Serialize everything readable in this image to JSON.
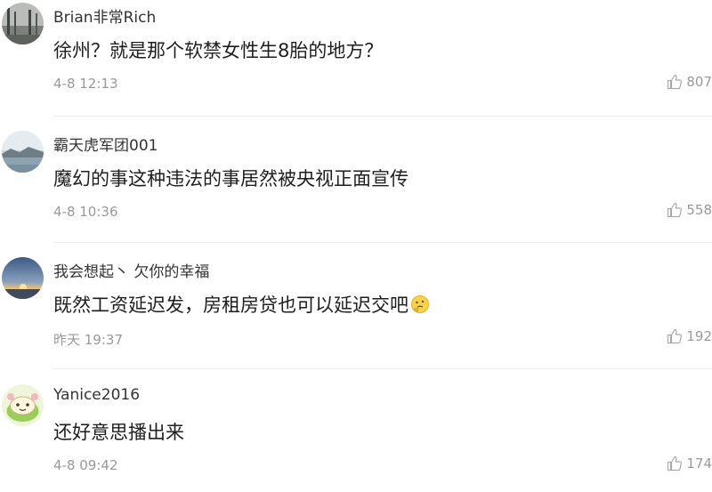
{
  "comments": [
    {
      "username": "Brian非常Rich",
      "content": "徐州？就是那个软禁女性生8胎的地方？",
      "time": "4-8 12:13",
      "likes": "807",
      "avatar_icon": "avatar-landscape-icon"
    },
    {
      "username": "霸天虎军团001",
      "content": "魔幻的事这种违法的事居然被央视正面宣传",
      "time": "4-8 10:36",
      "likes": "558",
      "avatar_icon": "avatar-lake-icon"
    },
    {
      "username": "我会想起丶 欠你的幸福",
      "content": "既然工资延迟发，房租房贷也可以延迟交吧",
      "time": "昨天 19:37",
      "likes": "192",
      "avatar_icon": "avatar-sunset-icon",
      "emoji": "thinking-face-icon"
    },
    {
      "username": "Yanice2016",
      "content": "还好意思播出来",
      "time": "4-8 09:42",
      "likes": "174",
      "avatar_icon": "avatar-cartoon-icon"
    }
  ],
  "like_icon": "thumbs-up-icon"
}
